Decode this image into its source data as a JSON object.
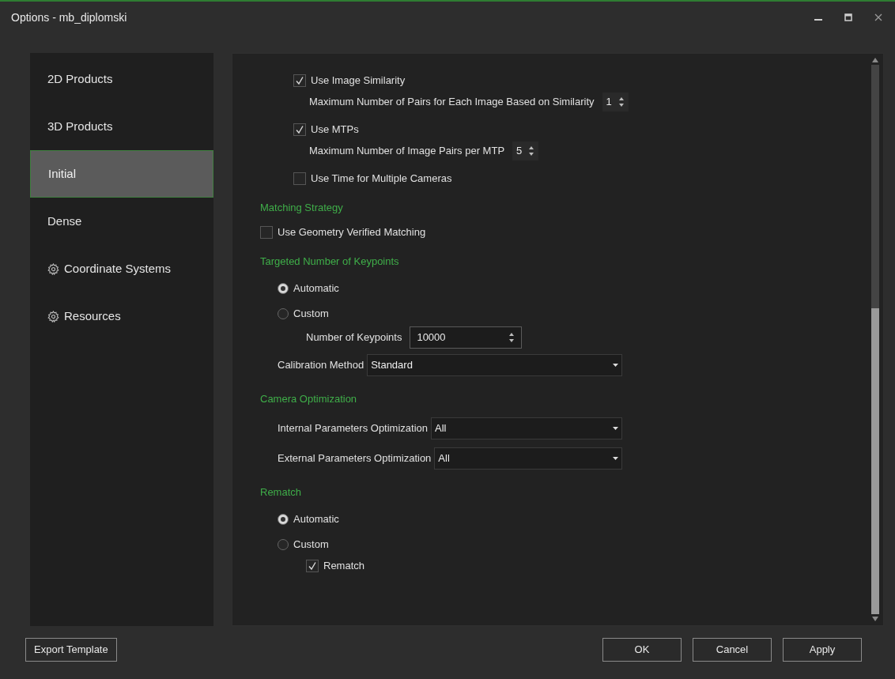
{
  "window": {
    "title": "Options - mb_diplomski"
  },
  "sidebar": {
    "items": [
      {
        "label": "2D Products",
        "kind": "plain",
        "selected": false
      },
      {
        "label": "3D Products",
        "kind": "plain",
        "selected": false
      },
      {
        "label": "Initial",
        "kind": "plain",
        "selected": true
      },
      {
        "label": "Dense",
        "kind": "plain",
        "selected": false
      },
      {
        "label": "Coordinate Systems",
        "kind": "gear",
        "selected": false
      },
      {
        "label": "Resources",
        "kind": "gear",
        "selected": false
      }
    ]
  },
  "sections": [
    {
      "items": [
        {
          "kind": "checkbox",
          "label": "Use Image Similarity",
          "checked": true,
          "children": [
            {
              "kind": "spin",
              "label": "Maximum Number of Pairs for Each Image Based on Similarity",
              "value": "1"
            }
          ]
        },
        {
          "kind": "checkbox",
          "label": "Use MTPs",
          "checked": true,
          "children": [
            {
              "kind": "spin",
              "label": "Maximum Number of Image Pairs per MTP",
              "value": "5"
            }
          ]
        },
        {
          "kind": "checkbox",
          "label": "Use Time for Multiple Cameras",
          "checked": false
        }
      ]
    },
    {
      "heading": "Matching Strategy",
      "items": [
        {
          "kind": "checkbox",
          "label": "Use Geometry Verified Matching",
          "checked": false
        }
      ]
    },
    {
      "heading": "Targeted Number of Keypoints",
      "items": [
        {
          "kind": "radio",
          "label": "Automatic",
          "selected": true
        },
        {
          "kind": "radio",
          "label": "Custom",
          "selected": false,
          "children": [
            {
              "kind": "number",
              "label": "Number of Keypoints",
              "value": "10000"
            }
          ]
        },
        {
          "kind": "combo",
          "label": "Calibration Method",
          "value": "Standard"
        }
      ]
    },
    {
      "heading": "Camera Optimization",
      "items": [
        {
          "kind": "combo",
          "label": "Internal Parameters Optimization",
          "value": "All"
        },
        {
          "kind": "combo",
          "label": "External Parameters Optimization",
          "value": "All"
        }
      ]
    },
    {
      "heading": "Rematch",
      "items": [
        {
          "kind": "radio",
          "label": "Automatic",
          "selected": true
        },
        {
          "kind": "radio",
          "label": "Custom",
          "selected": false,
          "children": [
            {
              "kind": "checkbox",
              "label": "Rematch",
              "checked": true
            }
          ]
        }
      ]
    }
  ],
  "buttons": {
    "left": [
      "Export Template"
    ],
    "right": [
      "OK",
      "Cancel",
      "Apply"
    ]
  }
}
